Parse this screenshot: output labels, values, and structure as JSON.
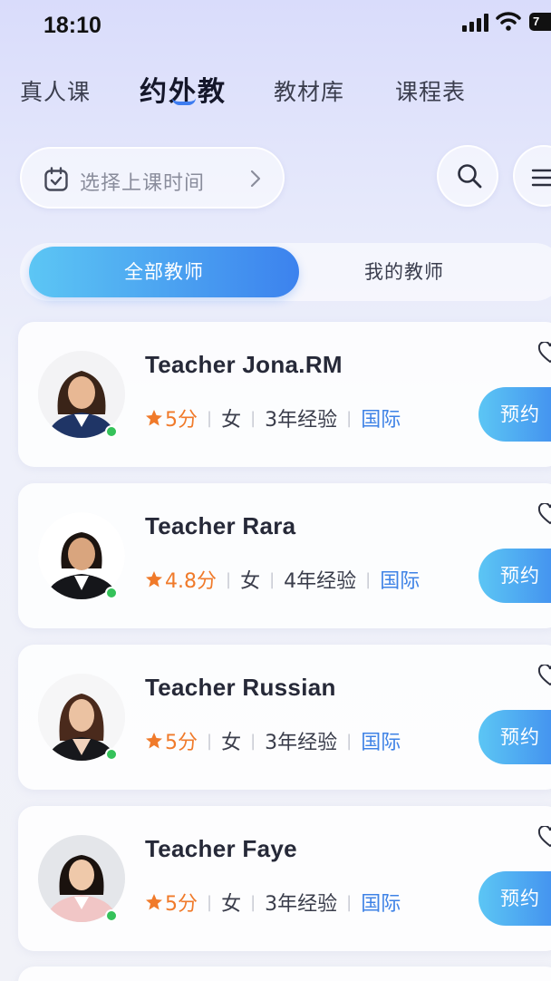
{
  "status_bar": {
    "time": "18:10",
    "battery": "7"
  },
  "top_tabs": [
    {
      "label": "真人课",
      "active": false
    },
    {
      "label": "约外教",
      "active": true
    },
    {
      "label": "教材库",
      "active": false
    },
    {
      "label": "课程表",
      "active": false
    }
  ],
  "time_picker": {
    "label": "选择上课时间"
  },
  "segments": {
    "all": "全部教师",
    "mine": "我的教师"
  },
  "colors": {
    "accent": "#3c82ee",
    "accent_light": "#5cc6f4",
    "rating": "#f07a2a",
    "online": "#35c25a",
    "region": "#3e82e6"
  },
  "teachers": [
    {
      "name": "Teacher Jona.RM",
      "rating": "5分",
      "gender": "女",
      "experience": "3年经验",
      "region": "国际",
      "book_label": "预约"
    },
    {
      "name": "Teacher Rara",
      "rating": "4.8分",
      "gender": "女",
      "experience": "4年经验",
      "region": "国际",
      "book_label": "预约"
    },
    {
      "name": "Teacher Russian",
      "rating": "5分",
      "gender": "女",
      "experience": "3年经验",
      "region": "国际",
      "book_label": "预约"
    },
    {
      "name": "Teacher Faye",
      "rating": "5分",
      "gender": "女",
      "experience": "3年经验",
      "region": "国际",
      "book_label": "预约"
    }
  ]
}
